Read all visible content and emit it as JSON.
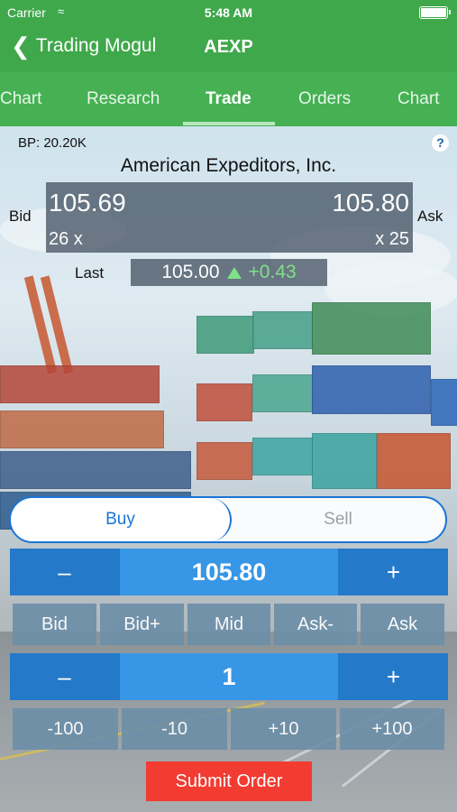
{
  "status_bar": {
    "carrier": "Carrier",
    "time": "5:48 AM"
  },
  "nav": {
    "back_label": "Trading Mogul",
    "title": "AEXP"
  },
  "tabs": [
    {
      "label": "Chart"
    },
    {
      "label": "Research"
    },
    {
      "label": "Trade",
      "active": true
    },
    {
      "label": "Orders"
    },
    {
      "label": "Chart"
    }
  ],
  "quote": {
    "buying_power": "BP: 20.20K",
    "help": "?",
    "company": "American Expeditors, Inc.",
    "bid_label": "Bid",
    "ask_label": "Ask",
    "bid": "105.69",
    "ask": "105.80",
    "bid_size": "26 x",
    "ask_size": "x 25",
    "last_label": "Last",
    "last": "105.00",
    "change": "+0.43"
  },
  "order": {
    "buy_label": "Buy",
    "sell_label": "Sell",
    "side_selected": "Buy",
    "minus": "–",
    "plus": "+",
    "price": "105.80",
    "price_buttons": [
      "Bid",
      "Bid+",
      "Mid",
      "Ask-",
      "Ask"
    ],
    "quantity": "1",
    "qty_buttons": [
      "-100",
      "-10",
      "+10",
      "+100"
    ],
    "submit_label": "Submit Order"
  },
  "colors": {
    "nav_green": "#3fa84b",
    "tab_green": "#45b153",
    "accent_blue": "#2479c9",
    "stepper_value_blue": "#3796e6",
    "submit_red": "#f23b31",
    "gain_green": "#7fe08a"
  },
  "icons": [
    "wifi-icon",
    "battery-icon",
    "back-chevron-icon",
    "help-icon",
    "up-triangle-icon"
  ]
}
